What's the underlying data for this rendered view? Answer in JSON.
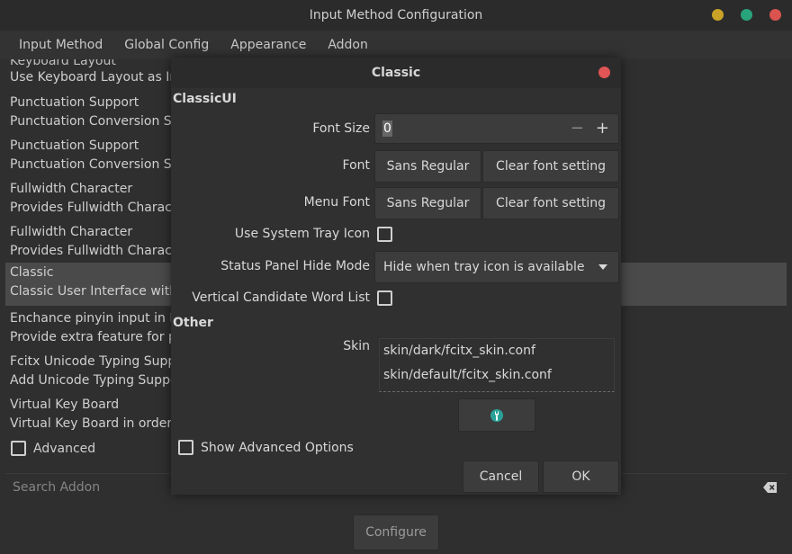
{
  "window": {
    "title": "Input Method Configuration",
    "buttons": [
      {
        "name": "minimize-button",
        "color": "#c9a227"
      },
      {
        "name": "maximize-button",
        "color": "#29a37b"
      },
      {
        "name": "close-button",
        "color": "#d9534f"
      }
    ]
  },
  "menu": [
    "Input Method",
    "Global Config",
    "Appearance",
    "Addon"
  ],
  "addon_list": {
    "partial_top": "Keyboard Layout",
    "items": [
      {
        "title": "Use Keyboard Layout as In",
        "desc": ""
      },
      {
        "title": "Punctuation Support",
        "desc": "Punctuation Conversion Su"
      },
      {
        "title": "Punctuation Support",
        "desc": "Punctuation Conversion Su"
      },
      {
        "title": "Fullwidth Character",
        "desc": "Provides Fullwidth Charac"
      },
      {
        "title": "Fullwidth Character",
        "desc": "Provides Fullwidth Charac"
      },
      {
        "title": "Classic",
        "desc": "Classic User Interface with"
      },
      {
        "title": "Enchance pinyin input in F",
        "desc": "Provide extra feature for p"
      },
      {
        "title": "Fcitx Unicode Typing Supp",
        "desc": "Add Unicode Typing Suppo"
      },
      {
        "title": "Virtual Key Board",
        "desc": "Virtual Key Board in order"
      }
    ],
    "selected_index": 5
  },
  "advanced_label": "Advanced",
  "search": {
    "placeholder": "Search Addon",
    "value": ""
  },
  "configure_label": "Configure",
  "dialog": {
    "title": "Classic",
    "section_classicui": "ClassicUI",
    "font_size_label": "Font Size",
    "font_size_value": "0",
    "font_label": "Font",
    "font_value": "Sans Regular",
    "clear_font": "Clear font setting",
    "menu_font_label": "Menu Font",
    "menu_font_value": "Sans Regular",
    "clear_menu_font": "Clear font setting",
    "tray_label": "Use System Tray Icon",
    "tray_checked": false,
    "status_label": "Status Panel Hide Mode",
    "status_value": "Hide when tray icon is available",
    "vertical_label": "Vertical Candidate Word List",
    "vertical_checked": false,
    "section_other": "Other",
    "skin_label": "Skin",
    "skins": [
      "skin/dark/fcitx_skin.conf",
      "skin/default/fcitx_skin.conf"
    ],
    "show_advanced_label": "Show Advanced Options",
    "cancel_label": "Cancel",
    "ok_label": "OK",
    "close_color": "#e05555",
    "accent_color": "#2aa198"
  }
}
